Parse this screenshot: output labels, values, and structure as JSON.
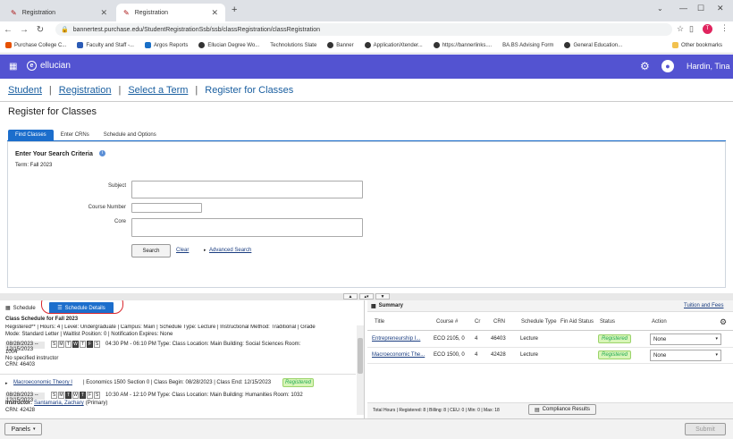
{
  "browser": {
    "tabs": [
      {
        "label": "Registration",
        "active": false
      },
      {
        "label": "Registration",
        "active": true
      }
    ],
    "url": "bannertest.purchase.edu/StudentRegistrationSsb/ssb/classRegistration/classRegistration",
    "bookmarks": [
      "Purchase College C...",
      "Faculty and Staff -...",
      "Argos Reports",
      "Ellucian Degree Wo...",
      "Technolutions Slate",
      "Banner",
      "ApplicationXtender...",
      "https://bannerlinks....",
      "BA.BS Advising Form",
      "General Education...",
      "Other bookmarks"
    ],
    "profile_initial": "T"
  },
  "app": {
    "brand": "ellucian",
    "user_name": "Hardin, Tina",
    "accent": "#5353d1"
  },
  "breadcrumb": [
    "Student",
    "Registration",
    "Select a Term",
    "Register for Classes"
  ],
  "page_title": "Register for Classes",
  "top_tabs": [
    "Find Classes",
    "Enter CRNs",
    "Schedule and Options"
  ],
  "search": {
    "heading": "Enter Your Search Criteria",
    "term": "Term: Fall 2023",
    "subject_label": "Subject",
    "course_number_label": "Course Number",
    "core_label": "Core",
    "search_button": "Search",
    "clear_link": "Clear",
    "advanced_link": "Advanced Search"
  },
  "bottom_tabs": [
    "Schedule",
    "Schedule Details"
  ],
  "schedule": {
    "heading": "Class Schedule for Fall 2023",
    "course1": {
      "line1": "Registered** | Hours: 4 | Level: Undergraduate | Campus: Main | Schedule Type: Lecture | Instructional Method: Traditional | Grade",
      "line2": "Mode: Standard Letter | Waitlist Position: 0 | Notification Expires: None",
      "dates": "08/28/2023 -- 12/15/2023",
      "days": [
        "S",
        "M",
        "T",
        "W",
        "T",
        "F",
        "S"
      ],
      "meeting": "04:30 PM - 06:10 PM Type: Class Location: Main Building: Social Sciences Room:",
      "room": "1004",
      "instructor": "No specified instructor",
      "crn": "CRN: 46403"
    },
    "course2": {
      "title": "Macroeconomic Theory I",
      "info": "| Economics 1500 Section 0 | Class Begin: 08/28/2023 | Class End: 12/15/2023",
      "status": "Registered",
      "dates": "08/28/2023 -- 12/15/2023",
      "days": [
        "S",
        "M",
        "T",
        "W",
        "T",
        "F",
        "S"
      ],
      "meeting": "10:30 AM - 12:10 PM Type: Class Location: Main Building: Humanities Room: 1032",
      "instructor_label": "Instructor:",
      "instructor": "Santamaria, Zachary",
      "instructor_role": "(Primary)",
      "crn": "CRN: 42428"
    }
  },
  "summary": {
    "title": "Summary",
    "tuition_link": "Tuition and Fees",
    "columns": [
      "Title",
      "Course #",
      "Cr",
      "CRN",
      "Schedule Type",
      "Fin Aid Status",
      "Status",
      "Action"
    ],
    "rows": [
      {
        "title": "Entrepreneurship I...",
        "course": "ECO 2105, 0",
        "cr": "4",
        "crn": "46403",
        "type": "Lecture",
        "status": "Registered",
        "action": "None"
      },
      {
        "title": "Macroeconomic The...",
        "course": "ECO 1500, 0",
        "cr": "4",
        "crn": "42428",
        "type": "Lecture",
        "status": "Registered",
        "action": "None"
      }
    ],
    "totals": "Total Hours | Registered: 8 | Billing: 8 | CEU: 0 | Min: 0 | Max: 18",
    "compliance_button": "Compliance Results"
  },
  "footer": {
    "panels": "Panels",
    "submit": "Submit"
  }
}
